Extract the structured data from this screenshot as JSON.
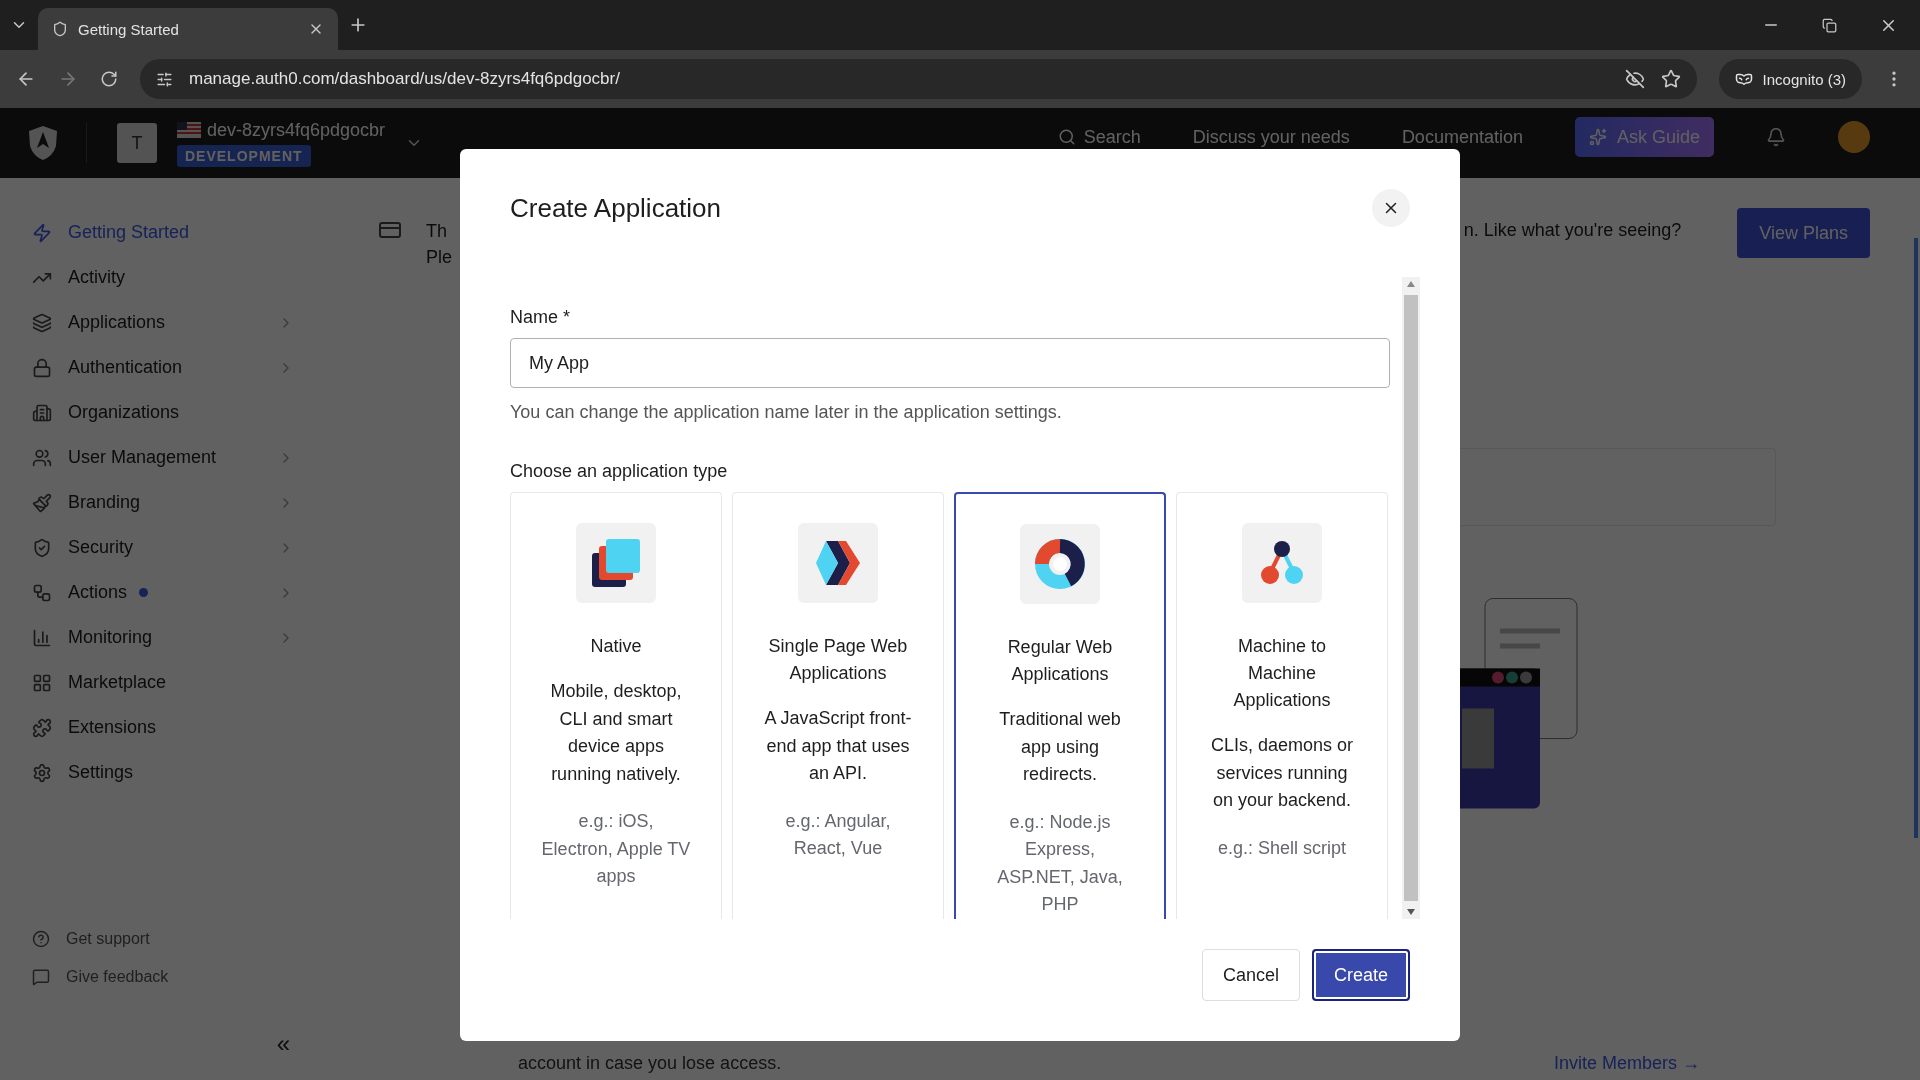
{
  "browser": {
    "tab_title": "Getting Started",
    "url": "manage.auth0.com/dashboard/us/dev-8zyrs4fq6pdgocbr/",
    "incognito": "Incognito (3)"
  },
  "header": {
    "tenant_initial": "T",
    "tenant_name": "dev-8zyrs4fq6pdgocbr",
    "environment": "DEVELOPMENT",
    "search": "Search",
    "links": [
      "Discuss your needs",
      "Documentation"
    ],
    "guide_button": "Ask Guide"
  },
  "sidebar": {
    "items": [
      {
        "label": "Getting Started",
        "selected": true,
        "submenu": false,
        "dot": false
      },
      {
        "label": "Activity",
        "selected": false,
        "submenu": false,
        "dot": false
      },
      {
        "label": "Applications",
        "selected": false,
        "submenu": true,
        "dot": false
      },
      {
        "label": "Authentication",
        "selected": false,
        "submenu": true,
        "dot": false
      },
      {
        "label": "Organizations",
        "selected": false,
        "submenu": false,
        "dot": false
      },
      {
        "label": "User Management",
        "selected": false,
        "submenu": true,
        "dot": false
      },
      {
        "label": "Branding",
        "selected": false,
        "submenu": true,
        "dot": false
      },
      {
        "label": "Security",
        "selected": false,
        "submenu": true,
        "dot": false
      },
      {
        "label": "Actions",
        "selected": false,
        "submenu": true,
        "dot": true
      },
      {
        "label": "Monitoring",
        "selected": false,
        "submenu": true,
        "dot": false
      },
      {
        "label": "Marketplace",
        "selected": false,
        "submenu": false,
        "dot": false
      },
      {
        "label": "Extensions",
        "selected": false,
        "submenu": false,
        "dot": false
      },
      {
        "label": "Settings",
        "selected": false,
        "submenu": false,
        "dot": false
      }
    ],
    "footer_links": [
      "Get support",
      "Give feedback"
    ],
    "collapse": "«"
  },
  "banner": {
    "lines": [
      "Th",
      "Ple"
    ],
    "right_text": "n. Like what you're seeing?",
    "button": "View Plans"
  },
  "invite_link": "Invite Members →",
  "bottom_text": "account in case you lose access.",
  "modal": {
    "title": "Create Application",
    "name_label": "Name",
    "required_mark": "*",
    "name_value": "My App",
    "helper": "You can change the application name later in the application settings.",
    "type_heading": "Choose an application type",
    "app_types": [
      {
        "kind": "native",
        "title": "Native",
        "description": "Mobile, desktop, CLI and smart device apps running natively.",
        "examples": "e.g.: iOS, Electron, Apple TV apps",
        "selected": false
      },
      {
        "kind": "spa",
        "title": "Single Page Web Applications",
        "description": "A JavaScript front-end app that uses an API.",
        "examples": "e.g.: Angular, React, Vue",
        "selected": false
      },
      {
        "kind": "regular",
        "title": "Regular Web Applications",
        "description": "Traditional web app using redirects.",
        "examples": "e.g.: Node.js Express, ASP.NET, Java, PHP",
        "selected": true
      },
      {
        "kind": "m2m",
        "title": "Machine to Machine Applications",
        "description": "CLIs, daemons or services running on your backend.",
        "examples": "e.g.: Shell script",
        "selected": false
      }
    ],
    "buttons": [
      {
        "kind": "secondary",
        "label": "Cancel"
      },
      {
        "kind": "primary",
        "label": "Create"
      }
    ]
  }
}
